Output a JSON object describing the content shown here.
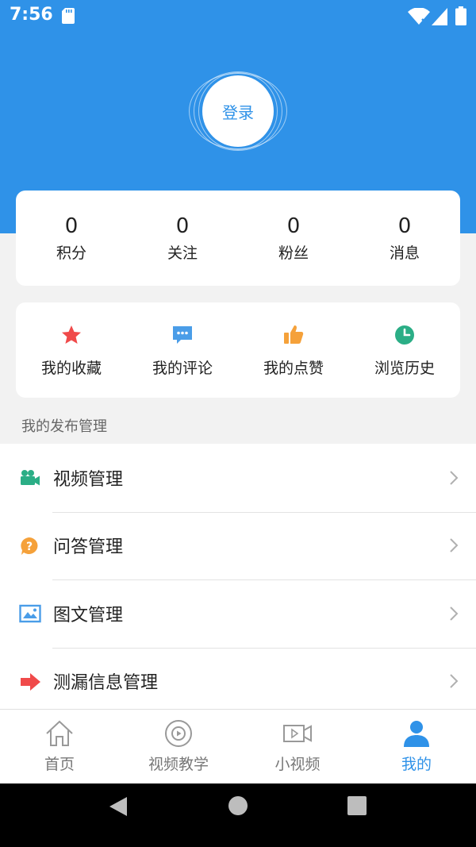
{
  "status_bar": {
    "time": "7:56",
    "icons": [
      "sd-card-icon",
      "wifi-icon",
      "signal-icon",
      "battery-icon"
    ]
  },
  "profile": {
    "login_label": "登录"
  },
  "stats": [
    {
      "value": "0",
      "label": "积分"
    },
    {
      "value": "0",
      "label": "关注"
    },
    {
      "value": "0",
      "label": "粉丝"
    },
    {
      "value": "0",
      "label": "消息"
    }
  ],
  "actions": [
    {
      "label": "我的收藏",
      "icon": "star-icon",
      "color": "#f04a4a"
    },
    {
      "label": "我的评论",
      "icon": "comment-icon",
      "color": "#4a9de8"
    },
    {
      "label": "我的点赞",
      "icon": "thumbs-up-icon",
      "color": "#f5a13a"
    },
    {
      "label": "浏览历史",
      "icon": "clock-icon",
      "color": "#2bae86"
    }
  ],
  "publish": {
    "section_title": "我的发布管理",
    "items": [
      {
        "label": "视频管理",
        "icon": "video-camera-icon",
        "color": "#2bae86"
      },
      {
        "label": "问答管理",
        "icon": "question-bubble-icon",
        "color": "#f5a13a"
      },
      {
        "label": "图文管理",
        "icon": "image-icon",
        "color": "#4a9de8"
      },
      {
        "label": "测漏信息管理",
        "icon": "arrow-right-icon",
        "color": "#f04a4a"
      }
    ]
  },
  "tabbar": {
    "tabs": [
      {
        "label": "首页",
        "icon": "home-icon"
      },
      {
        "label": "视频教学",
        "icon": "play-disc-icon"
      },
      {
        "label": "小视频",
        "icon": "video-frame-icon"
      },
      {
        "label": "我的",
        "icon": "user-icon",
        "active": true
      }
    ],
    "active_color": "#2f92e8",
    "inactive_color": "#777777"
  },
  "colors": {
    "brand": "#2f92e8",
    "background": "#f2f2f2"
  }
}
